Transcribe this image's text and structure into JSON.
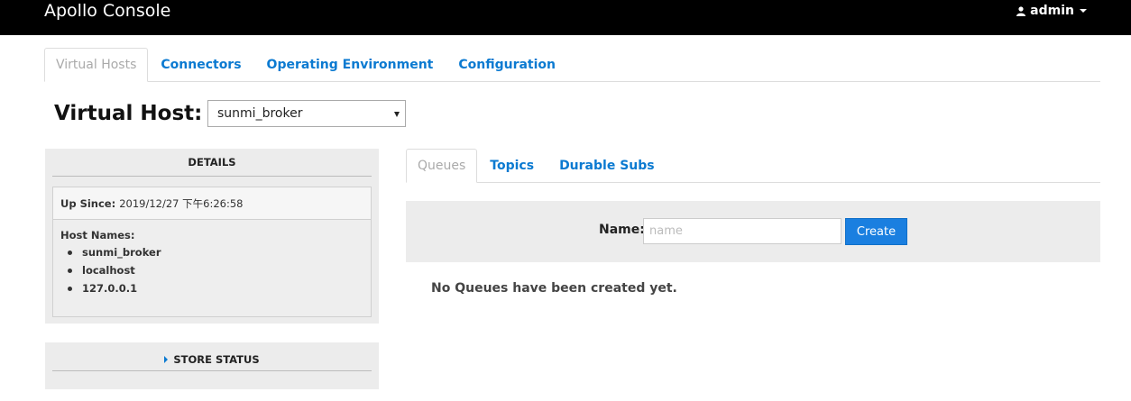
{
  "navbar": {
    "brand": "Apollo Console",
    "user": {
      "name": "admin",
      "icon": "user-icon"
    }
  },
  "top_tabs": [
    {
      "label": "Virtual Hosts",
      "active": true
    },
    {
      "label": "Connectors",
      "active": false
    },
    {
      "label": "Operating Environment",
      "active": false
    },
    {
      "label": "Configuration",
      "active": false
    }
  ],
  "virtual_host": {
    "label": "Virtual Host:",
    "selected": "sunmi_broker"
  },
  "details": {
    "header": "DETAILS",
    "up_since_label": "Up Since:",
    "up_since_value": "2019/12/27 下午6:26:58",
    "host_names_label": "Host Names:",
    "host_names": [
      "sunmi_broker",
      "localhost",
      "127.0.0.1"
    ]
  },
  "store_status": {
    "header": "STORE STATUS"
  },
  "sub_tabs": [
    {
      "label": "Queues",
      "active": true
    },
    {
      "label": "Topics",
      "active": false
    },
    {
      "label": "Durable Subs",
      "active": false
    }
  ],
  "create_form": {
    "name_label": "Name:",
    "name_placeholder": "name",
    "name_value": "",
    "create_label": "Create"
  },
  "empty_message": "No Queues have been created yet.",
  "colors": {
    "navbar_bg": "#000000",
    "link": "#0b7ad1",
    "button": "#1a7fe0",
    "panel_bg": "#ececec"
  }
}
